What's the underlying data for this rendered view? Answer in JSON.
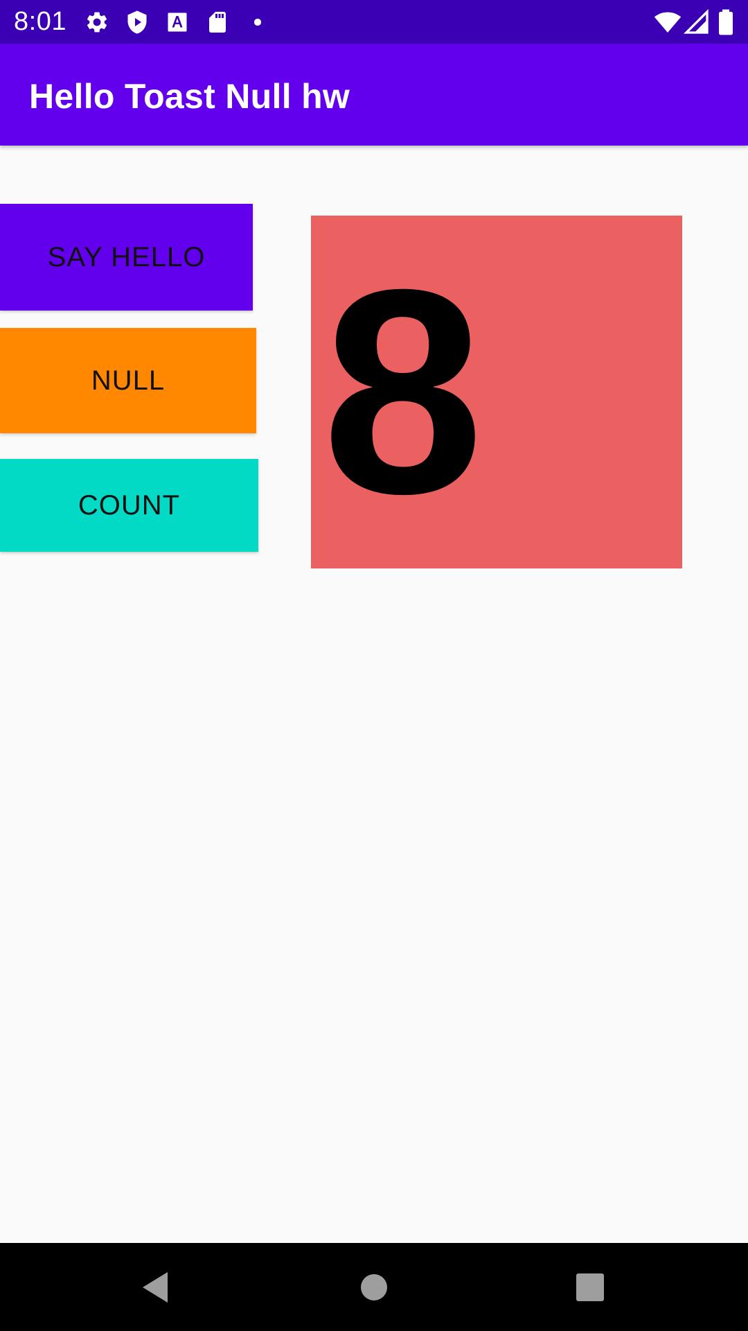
{
  "status_bar": {
    "time": "8:01",
    "left_icons": [
      "gear-icon",
      "play-protect-icon",
      "font-a-icon",
      "sd-card-icon",
      "dot-icon"
    ],
    "right_icons": [
      "wifi-icon",
      "cell-signal-icon",
      "battery-icon"
    ],
    "background": "#3b00b3"
  },
  "app_bar": {
    "title": "Hello Toast Null hw",
    "background": "#6200ee"
  },
  "buttons": {
    "say_hello": {
      "label": "SAY HELLO",
      "color": "#6200ee"
    },
    "null": {
      "label": "NULL",
      "color": "#ff8800"
    },
    "count": {
      "label": "COUNT",
      "color": "#03dac5"
    }
  },
  "counter": {
    "value": "8",
    "background": "#eb6060"
  },
  "nav_bar": {
    "buttons": [
      "back-icon",
      "home-icon",
      "recents-icon"
    ]
  }
}
